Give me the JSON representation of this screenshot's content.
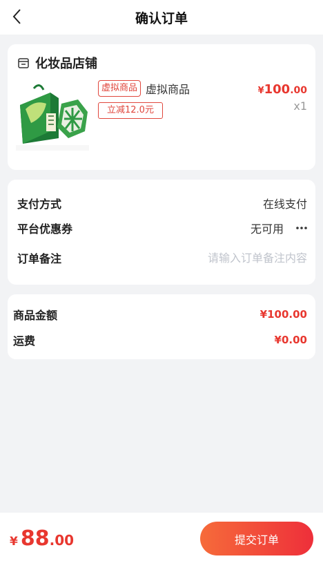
{
  "header": {
    "title": "确认订单"
  },
  "shop": {
    "name": "化妆品店铺",
    "product": {
      "tag": "虚拟商品",
      "name": "虚拟商品",
      "discount_tag": "立减12.0元",
      "price": {
        "currency": "¥",
        "integer": "100",
        "decimal": ".00"
      },
      "quantity": "x1",
      "image_icon": "gift-box-product-image"
    }
  },
  "order_info": {
    "payment": {
      "label": "支付方式",
      "value": "在线支付"
    },
    "coupon": {
      "label": "平台优惠券",
      "value": "无可用"
    },
    "remark": {
      "label": "订单备注",
      "placeholder": "请输入订单备注内容",
      "value": ""
    }
  },
  "amounts": {
    "goods": {
      "label": "商品金额",
      "value": "¥100.00"
    },
    "shipping": {
      "label": "运费",
      "value": "¥0.00"
    }
  },
  "footer": {
    "total": {
      "currency": "¥",
      "integer": "88",
      "decimal": ".00"
    },
    "submit_label": "提交订单"
  },
  "colors": {
    "accent": "#e8372f",
    "button_start": "#f66b3a",
    "button_end": "#ee2f3a"
  }
}
